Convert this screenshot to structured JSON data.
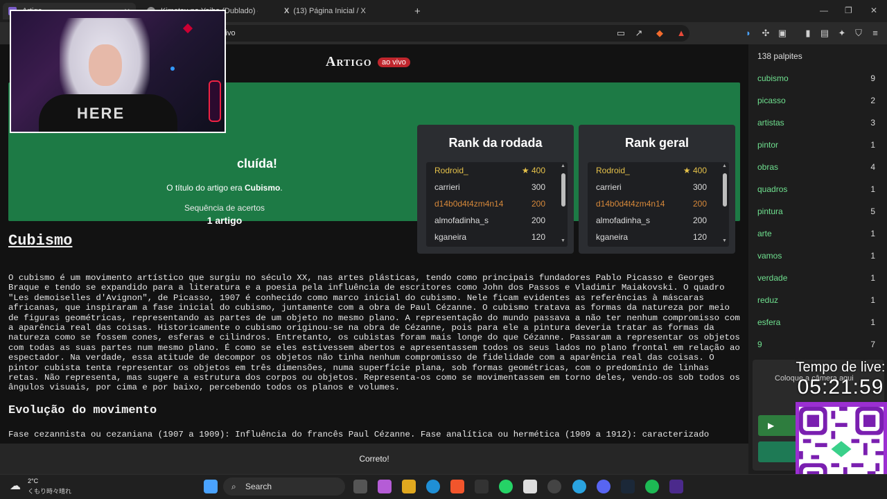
{
  "browser": {
    "tabs": [
      {
        "label": "Artigo"
      },
      {
        "label": "Kimetsu no Yaiba (Dublado) – Ep..."
      },
      {
        "label": "(13) Página Inicial / X"
      }
    ],
    "new_tab": "+",
    "url_fragment": "vivo",
    "window_controls": {
      "minimize": "—",
      "restore": "❐",
      "close": "✕"
    }
  },
  "header": {
    "logo": "Artigo",
    "live_badge": "ao vivo"
  },
  "banner": {
    "concluded": "cluída!",
    "title_prefix": "O título do artigo era ",
    "title_answer": "Cubismo",
    "title_suffix": ".",
    "streak_label": "Sequência de acertos",
    "streak_value": "1 artigo"
  },
  "rank_round": {
    "title": "Rank da rodada",
    "rows": [
      {
        "name": "Rodroid_",
        "score": "★ 400"
      },
      {
        "name": "carrieri",
        "score": "300"
      },
      {
        "name": "d14b0d4t4zm4n14",
        "score": "200"
      },
      {
        "name": "almofadinha_s",
        "score": "200"
      },
      {
        "name": "kganeira",
        "score": "120"
      }
    ]
  },
  "rank_overall": {
    "title": "Rank geral",
    "rows": [
      {
        "name": "Rodroid_",
        "score": "★ 400"
      },
      {
        "name": "carrieri",
        "score": "300"
      },
      {
        "name": "d14b0d4t4zm4n14",
        "score": "200"
      },
      {
        "name": "almofadinha_s",
        "score": "200"
      },
      {
        "name": "kganeira",
        "score": "120"
      }
    ]
  },
  "article": {
    "title": "Cubismo",
    "body": "O cubismo é um movimento artístico que surgiu no século XX, nas artes plásticas, tendo como principais fundadores Pablo Picasso e Georges Braque e tendo se expandido para a literatura e a poesia pela influência de escritores como John dos Passos e Vladimir Maiakovski. O quadro \"Les demoiselles d'Avignon\", de Picasso, 1907 é conhecido como marco inicial do cubismo. Nele ficam evidentes as referências à máscaras africanas, que inspiraram a fase inicial do cubismo, juntamente com a obra de Paul Cézanne. O cubismo tratava as formas da natureza por meio de figuras geométricas, representando as partes de um objeto no mesmo plano. A representação do mundo passava a não ter nenhum compromisso com a aparência real das coisas. Historicamente o cubismo originou-se na obra de Cézanne, pois para ele a pintura deveria tratar as formas da natureza como se fossem cones, esferas e cilindros. Entretanto, os cubistas foram mais longe do que Cézanne. Passaram a representar os objetos com todas as suas partes num mesmo plano. É como se eles estivessem abertos e apresentassem todos os seus lados no plano frontal em relação ao espectador. Na verdade, essa atitude de decompor os objetos não tinha nenhum compromisso de fidelidade com a aparência real das coisas. O pintor cubista tenta representar os objetos em três dimensões, numa superfície plana, sob formas geométricas, com o predomínio de linhas retas. Não representa, mas sugere a estrutura dos corpos ou objetos. Representa-os como se movimentassem em torno deles, vendo-os sob todos os ângulos visuais, por cima e por baixo, percebendo todos os planos e volumes.",
    "section_title": "Evolução do movimento",
    "section_body": "Fase cezannista ou cezaniana (1907 a 1909): Influência do francês Paul Cézanne. Fase analítica ou hermética (1909 a 1912): caracterizado"
  },
  "status": {
    "message": "Correto!"
  },
  "sidebar": {
    "guess_count": "138 palpites",
    "guesses": [
      {
        "word": "cubismo",
        "count": "9"
      },
      {
        "word": "picasso",
        "count": "2"
      },
      {
        "word": "artistas",
        "count": "3"
      },
      {
        "word": "pintor",
        "count": "1"
      },
      {
        "word": "obras",
        "count": "4"
      },
      {
        "word": "quadros",
        "count": "1"
      },
      {
        "word": "pintura",
        "count": "5"
      },
      {
        "word": "arte",
        "count": "1"
      },
      {
        "word": "vamos",
        "count": "1"
      },
      {
        "word": "verdade",
        "count": "1"
      },
      {
        "word": "reduz",
        "count": "1"
      },
      {
        "word": "esfera",
        "count": "1"
      },
      {
        "word": "9",
        "count": "7"
      }
    ],
    "camera_hint": "Coloque a câmera aqui"
  },
  "overlay": {
    "live_time_label": "Tempo de live:",
    "live_time_value": "05:21:59",
    "shirt_text": "HERE"
  },
  "taskbar": {
    "weather_temp": "2°C",
    "weather_desc": "くもり時々晴れ",
    "search": "Search"
  },
  "colors": {
    "banner": "#1d7a45",
    "guess_word": "#6fe08f",
    "live_badge": "#c0262d",
    "qr_border": "#9b2fd1"
  }
}
